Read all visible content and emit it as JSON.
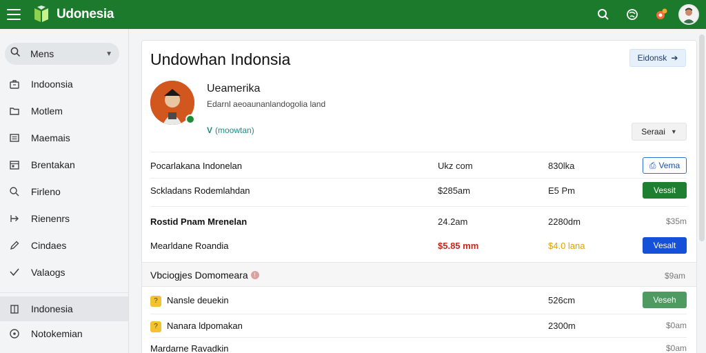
{
  "app": {
    "brand": "Udonesia",
    "colors": {
      "header": "#1c7a2c",
      "verify_green": "#1d7f2f",
      "verify_blue": "#1450d8",
      "amount_red": "#c4271c",
      "amount_amber": "#e0a100"
    }
  },
  "header": {
    "icons": [
      "menu-icon",
      "search-icon",
      "globe-icon",
      "notification-icon",
      "avatar"
    ]
  },
  "sidebar": {
    "search_label": "Mens",
    "items": [
      {
        "label": "Indoonsia",
        "icon": "briefcase-icon"
      },
      {
        "label": "Motlem",
        "icon": "folder-icon"
      },
      {
        "label": "Maemais",
        "icon": "list-icon"
      },
      {
        "label": "Brentakan",
        "icon": "calendar-icon"
      },
      {
        "label": "Firleno",
        "icon": "search-icon"
      },
      {
        "label": "Rienenrs",
        "icon": "export-icon"
      },
      {
        "label": "Cindaes",
        "icon": "pencil-icon"
      },
      {
        "label": "Valaogs",
        "icon": "check-icon"
      },
      {
        "label": "Indonesia",
        "icon": "building-icon"
      },
      {
        "label": "Notokemian",
        "icon": "circle-info-icon"
      }
    ],
    "active_index": 8
  },
  "main": {
    "title": "Undowhan Indonsia",
    "edit_label": "Eidonsk",
    "profile": {
      "name": "Ueamerika",
      "subtitle": "Edarnl aeoaunanlandogolia land",
      "badge_mark": "V",
      "badge_text": "(moowtan)"
    },
    "select_label": "Seraai",
    "rows": [
      {
        "name": "Pocarlakana Indonelan",
        "col2": "Ukz com",
        "col3": "830lka",
        "action": "Vema",
        "style": "outline"
      },
      {
        "name": "Sckladans Rodemlahdan",
        "col2": "$285am",
        "col3": "E5 Pm",
        "action": "Vessit",
        "style": "green"
      },
      {
        "name": "Rostid Pnam Mrenelan",
        "col2": "24.2am",
        "col3": "2280dm",
        "action": "$35m",
        "style": "text"
      },
      {
        "name": "Mearldane Roandia",
        "col2": "$5.85 mm",
        "col3": "$4.0 lana",
        "action": "Vesalt",
        "style": "blue"
      }
    ],
    "section": {
      "title": "Vbciogjes Domomeara",
      "amount": "$9am"
    },
    "items": [
      {
        "name": "Nansle deuekin",
        "value": "526cm",
        "action": "Veseh",
        "style": "green-soft"
      },
      {
        "name": "Nanara ldpomakan",
        "value": "2300m",
        "action": "$0am",
        "style": "text"
      },
      {
        "name": "Mardarne Ravadkin",
        "value": "",
        "action": "$0am",
        "style": "text"
      }
    ]
  }
}
